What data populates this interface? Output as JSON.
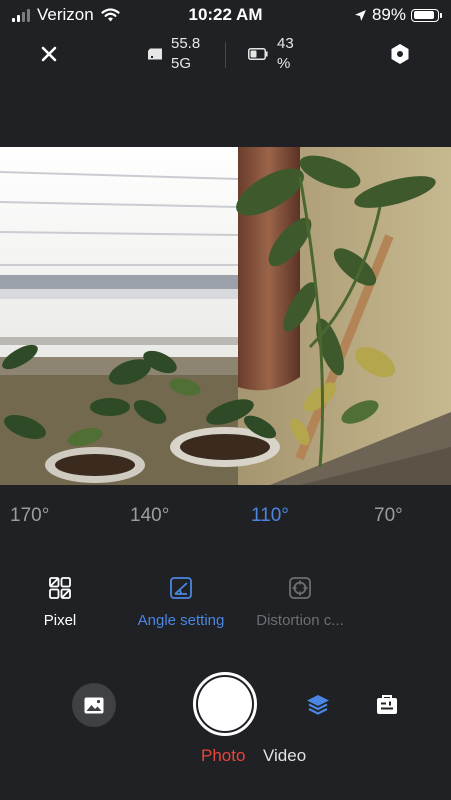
{
  "status_bar": {
    "carrier": "Verizon",
    "time": "10:22 AM",
    "battery": "89%",
    "battery_level": 0.89
  },
  "top_bar": {
    "storage_value": "55.8",
    "storage_unit": "5G",
    "camera_battery_value": "43",
    "camera_battery_unit": "%"
  },
  "angles": {
    "items": [
      "170°",
      "140°",
      "110°",
      "70°"
    ],
    "active": "110°"
  },
  "modes": {
    "items": [
      "Pixel",
      "Angle setting",
      "Distortion c..."
    ],
    "active": "Angle setting"
  },
  "capture": {
    "tabs": [
      "Photo",
      "Video"
    ],
    "active": "Photo"
  },
  "colors": {
    "accent_blue": "#4b86e3",
    "accent_red": "#e8443a",
    "background": "#1f2124",
    "inactive_text": "#9a9c9f",
    "disabled_text": "#6c6e72"
  }
}
